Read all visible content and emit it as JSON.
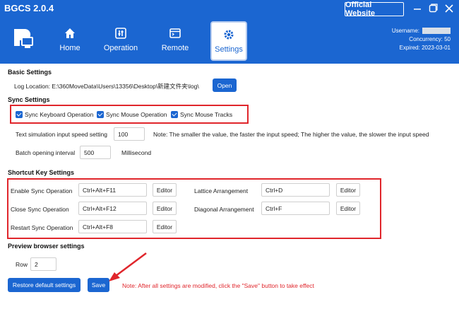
{
  "app": {
    "title": "BGCS 2.0.4",
    "official_website": "Official Website"
  },
  "nav": {
    "home": "Home",
    "operation": "Operation",
    "remote": "Remote",
    "settings": "Settings"
  },
  "account": {
    "username_label": "Username:",
    "concurrency": "Concurrency: 50",
    "expired": "Expired:   2023-03-01"
  },
  "basic": {
    "title": "Basic Settings",
    "log_location": "Log Location: E:\\360MoveData\\Users\\13356\\Desktop\\新建文件夹\\log\\",
    "open": "Open"
  },
  "sync": {
    "title": "Sync Settings",
    "keyboard": "Sync Keyboard Operation",
    "mouse": "Sync Mouse Operation",
    "tracks": "Sync Mouse Tracks",
    "speed_label": "Text simulation input speed setting",
    "speed_value": "100",
    "speed_note": "Note: The smaller the value, the faster the input speed; The higher the value, the slower the input speed",
    "batch_label": "Batch opening interval",
    "batch_value": "500",
    "batch_unit": "Millisecond"
  },
  "shortcut": {
    "title": "Shortcut Key Settings",
    "editor": "Editor",
    "enable_label": "Enable Sync Operation",
    "enable_value": "Ctrl+Alt+F11",
    "close_label": "Close Sync Operation",
    "close_value": "Ctrl+Alt+F12",
    "restart_label": "Restart Sync Operation",
    "restart_value": "Ctrl+Alt+F8",
    "lattice_label": "Lattice Arrangement",
    "lattice_value": "Ctrl+D",
    "diagonal_label": "Diagonal Arrangement",
    "diagonal_value": "Ctrl+F"
  },
  "preview": {
    "title": "Preview browser settings",
    "row_label": "Row",
    "row_value": "2"
  },
  "footer": {
    "restore": "Restore default settings",
    "save": "Save",
    "note": "Note: After all settings are modified, click the \"Save\" button to take effect"
  },
  "colors": {
    "primary": "#1b66d1",
    "highlight": "#e0262c"
  }
}
